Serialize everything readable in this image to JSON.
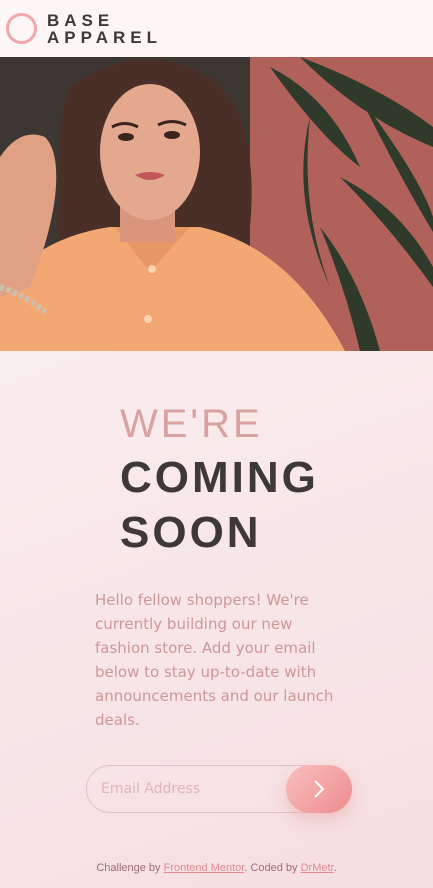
{
  "header": {
    "logo_line_1": "BASE",
    "logo_line_2": "APPAREL"
  },
  "hero": {
    "image_icon": "woman-portrait-photo"
  },
  "headline": {
    "light": "WE'RE",
    "bold_line_1": "COMING",
    "bold_line_2": "SOON"
  },
  "description": "Hello fellow shoppers! We're currently building our new fashion store. Add your email below to stay up-to-date with announcements and our launch deals.",
  "form": {
    "email_placeholder": "Email Address",
    "submit_icon": "chevron-right-icon"
  },
  "footer": {
    "prefix": "Challenge by ",
    "link1": "Frontend Mentor",
    "middle": ". Coded by ",
    "link2": "DrMetr",
    "suffix": "."
  },
  "colors": {
    "accent": "#f2a7ab",
    "text_dark": "#3e3838",
    "text_pink": "#ce9797",
    "button_gradient_start": "#f8bfbf",
    "button_gradient_end": "#ee8c8d"
  }
}
